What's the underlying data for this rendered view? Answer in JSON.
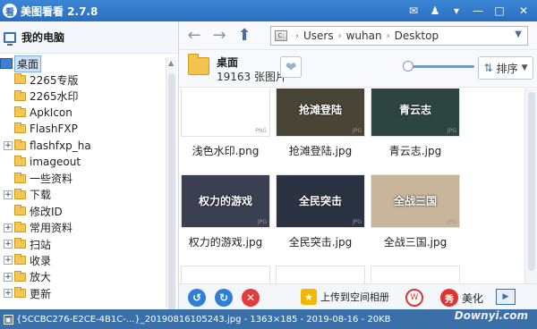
{
  "window": {
    "title": "美图看看 2.7.8",
    "logo_glyph": "看"
  },
  "left_panel": {
    "header": "我的电脑",
    "root": "桌面",
    "folders": [
      {
        "label": "2265专版",
        "expandable": false
      },
      {
        "label": "2265水印",
        "expandable": false
      },
      {
        "label": "ApkIcon",
        "expandable": false
      },
      {
        "label": "FlashFXP",
        "expandable": false
      },
      {
        "label": "flashfxp_ha",
        "expandable": true
      },
      {
        "label": "imageout",
        "expandable": false
      },
      {
        "label": "一些资料",
        "expandable": false
      },
      {
        "label": "下载",
        "expandable": true
      },
      {
        "label": "修改ID",
        "expandable": false
      },
      {
        "label": "常用资料",
        "expandable": true
      },
      {
        "label": "扫站",
        "expandable": true
      },
      {
        "label": "收录",
        "expandable": true
      },
      {
        "label": "放大",
        "expandable": true
      },
      {
        "label": "更新",
        "expandable": true
      }
    ]
  },
  "nav": {
    "path": [
      "Users",
      "wuhan",
      "Desktop"
    ],
    "drive_label": "C:"
  },
  "folder_info": {
    "name": "桌面",
    "count": "19163 张图片"
  },
  "sort": {
    "label": "排序"
  },
  "thumbnails": [
    {
      "caption": "浅色水印.png",
      "format": "PNG",
      "overlay": "",
      "bg": "#ffffff"
    },
    {
      "caption": "抢滩登陆.jpg",
      "format": "JPG",
      "overlay": "抢滩登陆",
      "bg": "#4a4437"
    },
    {
      "caption": "青云志.jpg",
      "format": "JPG",
      "overlay": "青云志",
      "bg": "#2d4540"
    },
    {
      "caption": "权力的游戏.jpg",
      "format": "JPG",
      "overlay": "权力的游戏",
      "bg": "#3a3f52"
    },
    {
      "caption": "全民突击.jpg",
      "format": "JPG",
      "overlay": "全民突击",
      "bg": "#2b3342"
    },
    {
      "caption": "全战三国.jpg",
      "format": "JPG",
      "overlay": "全战三国",
      "bg": "#c9b59a"
    }
  ],
  "toolbar": {
    "upload_label": "上传到空间相册",
    "beautify_label": "美化"
  },
  "status": {
    "text": "{5CCBC276-E2CE-4B1C-...}_20190816105243.jpg - 1363×185 - 2019-08-16 - 20KB"
  },
  "watermark": "Downyi.com",
  "colors": {
    "titlebar": "#2a6fbf",
    "status": "#3a6fa8",
    "accent": "#2f7fd6",
    "delete": "#e23b3b"
  }
}
